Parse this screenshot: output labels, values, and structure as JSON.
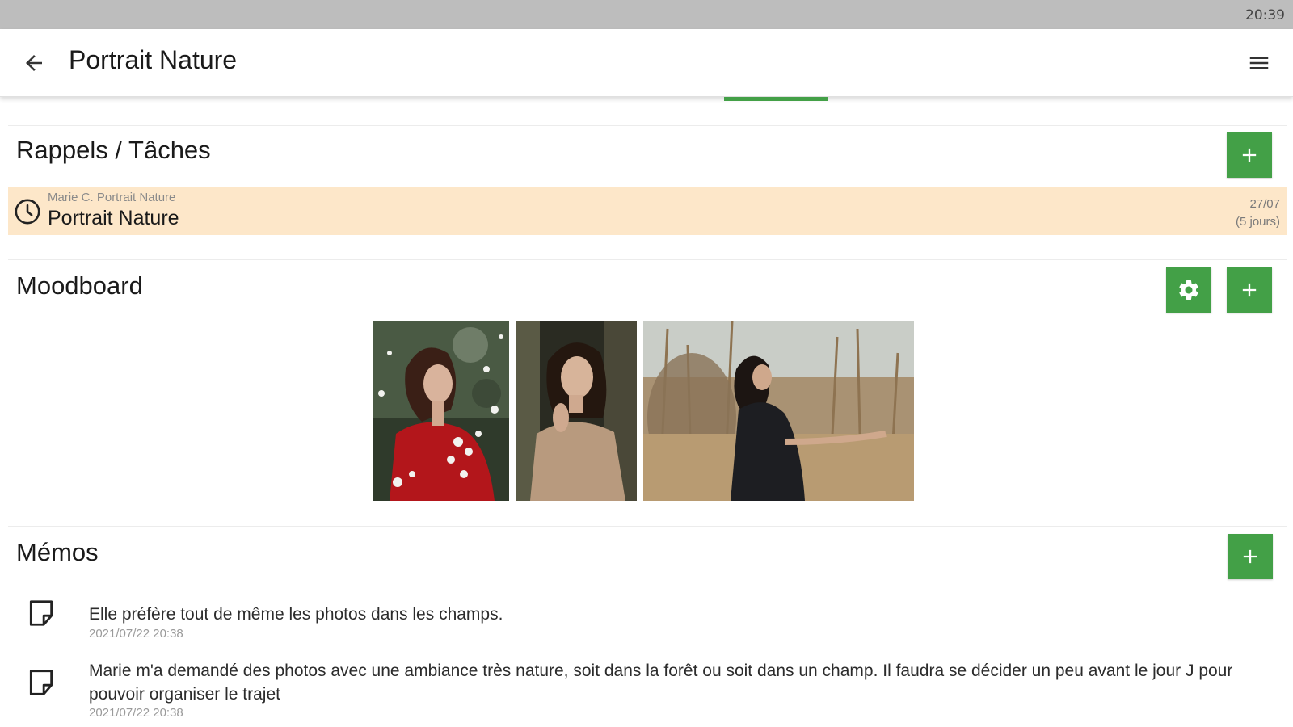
{
  "status_bar": {
    "time": "20:39"
  },
  "app_bar": {
    "title": "Portrait Nature",
    "back_icon": "arrow-left-icon",
    "menu_icon": "hamburger-menu-icon"
  },
  "colors": {
    "accent": "#43a047",
    "reminder_bg": "#fde7c9"
  },
  "reminders": {
    "title": "Rappels / Tâches",
    "items": [
      {
        "subtitle": "Marie C.  Portrait Nature",
        "title": "Portrait Nature",
        "date": "27/07",
        "days": "(5 jours)"
      }
    ]
  },
  "moodboard": {
    "title": "Moodboard"
  },
  "memos": {
    "title": "Mémos",
    "items": [
      {
        "text": "Elle préfère tout de même les photos dans les champs.",
        "timestamp": "2021/07/22 20:38"
      },
      {
        "text": "Marie m'a demandé des photos avec une ambiance très nature, soit dans la forêt ou soit dans un champ. Il faudra se décider un peu avant le jour J pour pouvoir organiser le trajet",
        "timestamp": "2021/07/22 20:38"
      }
    ]
  }
}
